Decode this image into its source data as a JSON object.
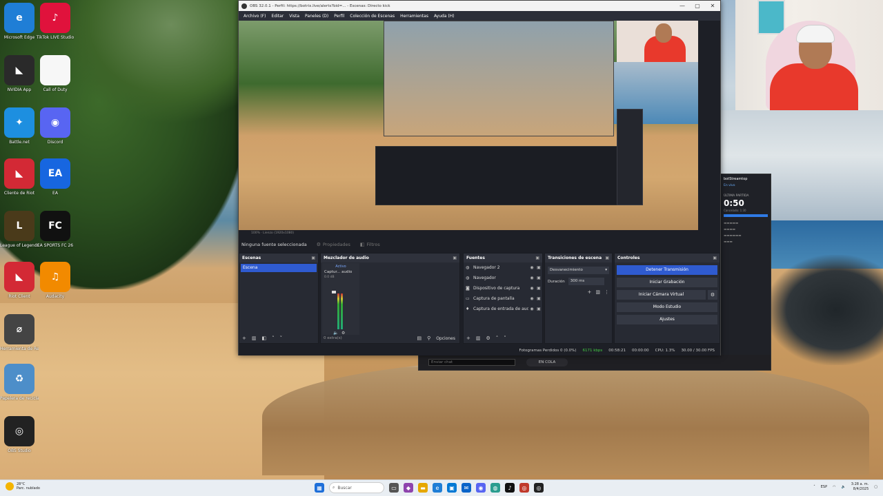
{
  "desktop": {
    "icons": [
      {
        "label": "Microsoft Edge",
        "glyph": "e",
        "bg": "#1f7ed6"
      },
      {
        "label": "TikTok LIVE Studio",
        "glyph": "♪",
        "bg": "#e0123c"
      },
      {
        "label": "NVIDIA App",
        "glyph": "◣",
        "bg": "#2a2a2a"
      },
      {
        "label": "Call of Duty",
        "glyph": "",
        "bg": "#f7f7f7"
      },
      {
        "label": "Battle.net",
        "glyph": "✦",
        "bg": "#1d8fe0"
      },
      {
        "label": "Discord",
        "glyph": "◉",
        "bg": "#5865f2"
      },
      {
        "label": "Cliente de Riot",
        "glyph": "◣",
        "bg": "#d32935"
      },
      {
        "label": "EA",
        "glyph": "EA",
        "bg": "#1766e0"
      },
      {
        "label": "League of Legends",
        "glyph": "L",
        "bg": "#4a3a1a"
      },
      {
        "label": "EA SPORTS FC 26",
        "glyph": "FC",
        "bg": "#111"
      },
      {
        "label": "Riot Client",
        "glyph": "◣",
        "bg": "#d32935"
      },
      {
        "label": "Audacity",
        "glyph": "♫",
        "bg": "#f28a00"
      },
      {
        "label": "Herramienta de Recortes",
        "glyph": "⌀",
        "bg": "#444"
      },
      {
        "label": "Papelera de reciclaje",
        "glyph": "♻",
        "bg": "#4d8ec9"
      },
      {
        "label": "OBS Studio",
        "glyph": "◎",
        "bg": "#222"
      }
    ]
  },
  "obs": {
    "title": "OBS 32.0.1 - Perfil: https://botrix.live/alerts?bid=...  - Escenas: Directo kick",
    "window_controls": [
      "—",
      "▢",
      "✕"
    ],
    "menu": [
      "Archivo (F)",
      "Editar",
      "Vista",
      "Paneles (D)",
      "Perfil",
      "Colección de Escenas",
      "Herramientas",
      "Ayuda (H)"
    ],
    "preview_status": "100%   ·   Lienzo (1920x1080)",
    "source_toolbar": {
      "no_selection": "Ninguna fuente seleccionada",
      "properties": "Propiedades",
      "filters": "Filtros"
    },
    "docks": {
      "scenes": {
        "title": "Escenas",
        "items": [
          "Escena"
        ]
      },
      "mixer": {
        "title": "Mezclador de audio",
        "strip_label": "Activo",
        "strip_name": "Captur... audio",
        "strip_db": "0.0 dB",
        "footer": "0 extra(s)"
      },
      "sources": {
        "title": "Fuentes",
        "items": [
          {
            "name": "Navegador 2",
            "icon": "globe-icon",
            "glyph": "◍"
          },
          {
            "name": "Navegador",
            "icon": "globe-icon",
            "glyph": "◍"
          },
          {
            "name": "Dispositivo de captura",
            "icon": "camera-icon",
            "glyph": "◙"
          },
          {
            "name": "Captura de pantalla",
            "icon": "monitor-icon",
            "glyph": "▭"
          },
          {
            "name": "Captura de entrada de audio",
            "icon": "microphone-icon",
            "glyph": "♦"
          }
        ]
      },
      "transitions": {
        "title": "Transiciones de escena",
        "selected": "Desvanecimiento",
        "duration_label": "Duración",
        "duration_value": "300 ms"
      },
      "controls": {
        "title": "Controles",
        "stop_stream": "Detener Transmisión",
        "start_recording": "Iniciar Grabación",
        "start_virtual_cam": "Iniciar Cámara Virtual",
        "studio_mode": "Modo Estudio",
        "settings": "Ajustes"
      }
    },
    "mixer_options": "Opciones",
    "statusbar": {
      "dropped_frames": "Fotogramas Perdidos 0 (0.0%)",
      "bitrate": "6171 kbps",
      "live_time": "00:58:21",
      "rec_time": "00:00:00",
      "cpu": "CPU: 1.3%",
      "fps": "30.00 / 30.00 FPS"
    }
  },
  "stream_manager": {
    "channel": "botStreamtop",
    "live": "En vivo",
    "prompt": "ÚLTIMA PARTIDA",
    "timer": "0:50",
    "timer_sub": "Cancelado: 1:30",
    "chat_placeholder": "Enviar chat",
    "queue": "EN COLA"
  },
  "taskbar": {
    "weather_temp": "28°C",
    "weather_desc": "Parc. nublado",
    "search": "Buscar",
    "clock_time": "3:28 a. m.",
    "clock_date": "8/4/2025",
    "lang": "ESP",
    "apps": [
      {
        "glyph": "▦",
        "bg": "#1e6fd9",
        "name": "windows-start-icon"
      },
      {
        "glyph": "▭",
        "bg": "#555",
        "name": "task-view-icon"
      },
      {
        "glyph": "◆",
        "bg": "#8e44ad",
        "name": "copilot-icon"
      },
      {
        "glyph": "▬",
        "bg": "#e6a700",
        "name": "file-explorer-icon"
      },
      {
        "glyph": "e",
        "bg": "#1f7ed6",
        "name": "edge-icon"
      },
      {
        "glyph": "▣",
        "bg": "#0078d4",
        "name": "store-icon"
      },
      {
        "glyph": "✉",
        "bg": "#0a64c9",
        "name": "mail-icon"
      },
      {
        "glyph": "◉",
        "bg": "#5865f2",
        "name": "discord-icon"
      },
      {
        "glyph": "◍",
        "bg": "#2a9d8f",
        "name": "browser-icon"
      },
      {
        "glyph": "♪",
        "bg": "#111",
        "name": "tiktok-icon"
      },
      {
        "glyph": "◎",
        "bg": "#c0392b",
        "name": "record-icon"
      },
      {
        "glyph": "◎",
        "bg": "#222",
        "name": "obs-icon"
      }
    ]
  }
}
